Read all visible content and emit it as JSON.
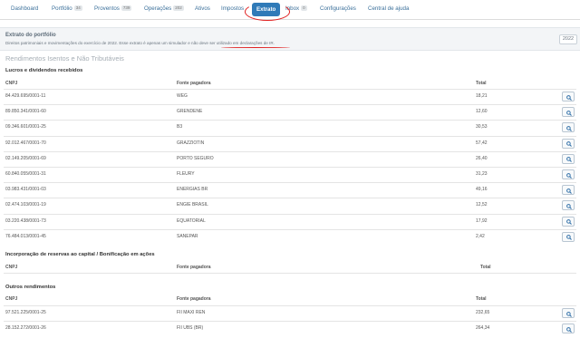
{
  "nav": {
    "items": [
      {
        "label": "Dashboard",
        "badge": ""
      },
      {
        "label": "Portfólio",
        "badge": "34"
      },
      {
        "label": "Proventos",
        "badge": "739"
      },
      {
        "label": "Operações",
        "badge": "202"
      },
      {
        "label": "Ativos",
        "badge": ""
      },
      {
        "label": "Impostos",
        "badge": ""
      },
      {
        "label": "Extrato",
        "badge": ""
      },
      {
        "label": "Inbox",
        "badge": "0"
      },
      {
        "label": "Configurações",
        "badge": ""
      },
      {
        "label": "Central de ajuda",
        "badge": ""
      }
    ],
    "active": "Extrato"
  },
  "info": {
    "title": "Extrato do portfólio",
    "text": "Direitos patrimoniais e movimentações do exercício de 2022. Esse extrato é apenas um simulador e não deve ser utilizado em declarações de IR.",
    "year": "2022"
  },
  "page_heading": "Rendimentos Isentos e Não Tributáveis",
  "columns": {
    "cnpj": "CNPJ",
    "fonte": "Fonte pagadora",
    "total": "Total"
  },
  "sections": {
    "lucros": {
      "title": "Lucros e dividendos recebidos",
      "rows": [
        {
          "cnpj": "84.429.695/0001-11",
          "fonte": "WEG",
          "total": "18,21"
        },
        {
          "cnpj": "89.850.341/0001-60",
          "fonte": "GRENDENE",
          "total": "12,60"
        },
        {
          "cnpj": "09.346.601/0001-25",
          "fonte": "B3",
          "total": "30,53"
        },
        {
          "cnpj": "92.012.467/0001-70",
          "fonte": "GRAZZIOTIN",
          "total": "57,42"
        },
        {
          "cnpj": "02.149.205/0001-69",
          "fonte": "PORTO SEGURO",
          "total": "26,40"
        },
        {
          "cnpj": "60.840.055/0001-31",
          "fonte": "FLEURY",
          "total": "31,23"
        },
        {
          "cnpj": "03.983.431/0001-03",
          "fonte": "ENERGIAS BR",
          "total": "49,16"
        },
        {
          "cnpj": "02.474.103/0001-19",
          "fonte": "ENGIE BRASIL",
          "total": "12,52"
        },
        {
          "cnpj": "03.220.438/0001-73",
          "fonte": "EQUATORIAL",
          "total": "17,92"
        },
        {
          "cnpj": "76.484.013/0001-45",
          "fonte": "SANEPAR",
          "total": "2,42"
        }
      ]
    },
    "incorporacao": {
      "title": "Incorporação de reservas ao capital / Bonificação em ações",
      "rows": []
    },
    "outros": {
      "title": "Outros rendimentos",
      "rows": [
        {
          "cnpj": "97.521.225/0001-25",
          "fonte": "FII MAXI REN",
          "total": "232,65"
        },
        {
          "cnpj": "28.152.272/0001-26",
          "fonte": "FII UBS (BR)",
          "total": "264,34"
        }
      ]
    }
  }
}
